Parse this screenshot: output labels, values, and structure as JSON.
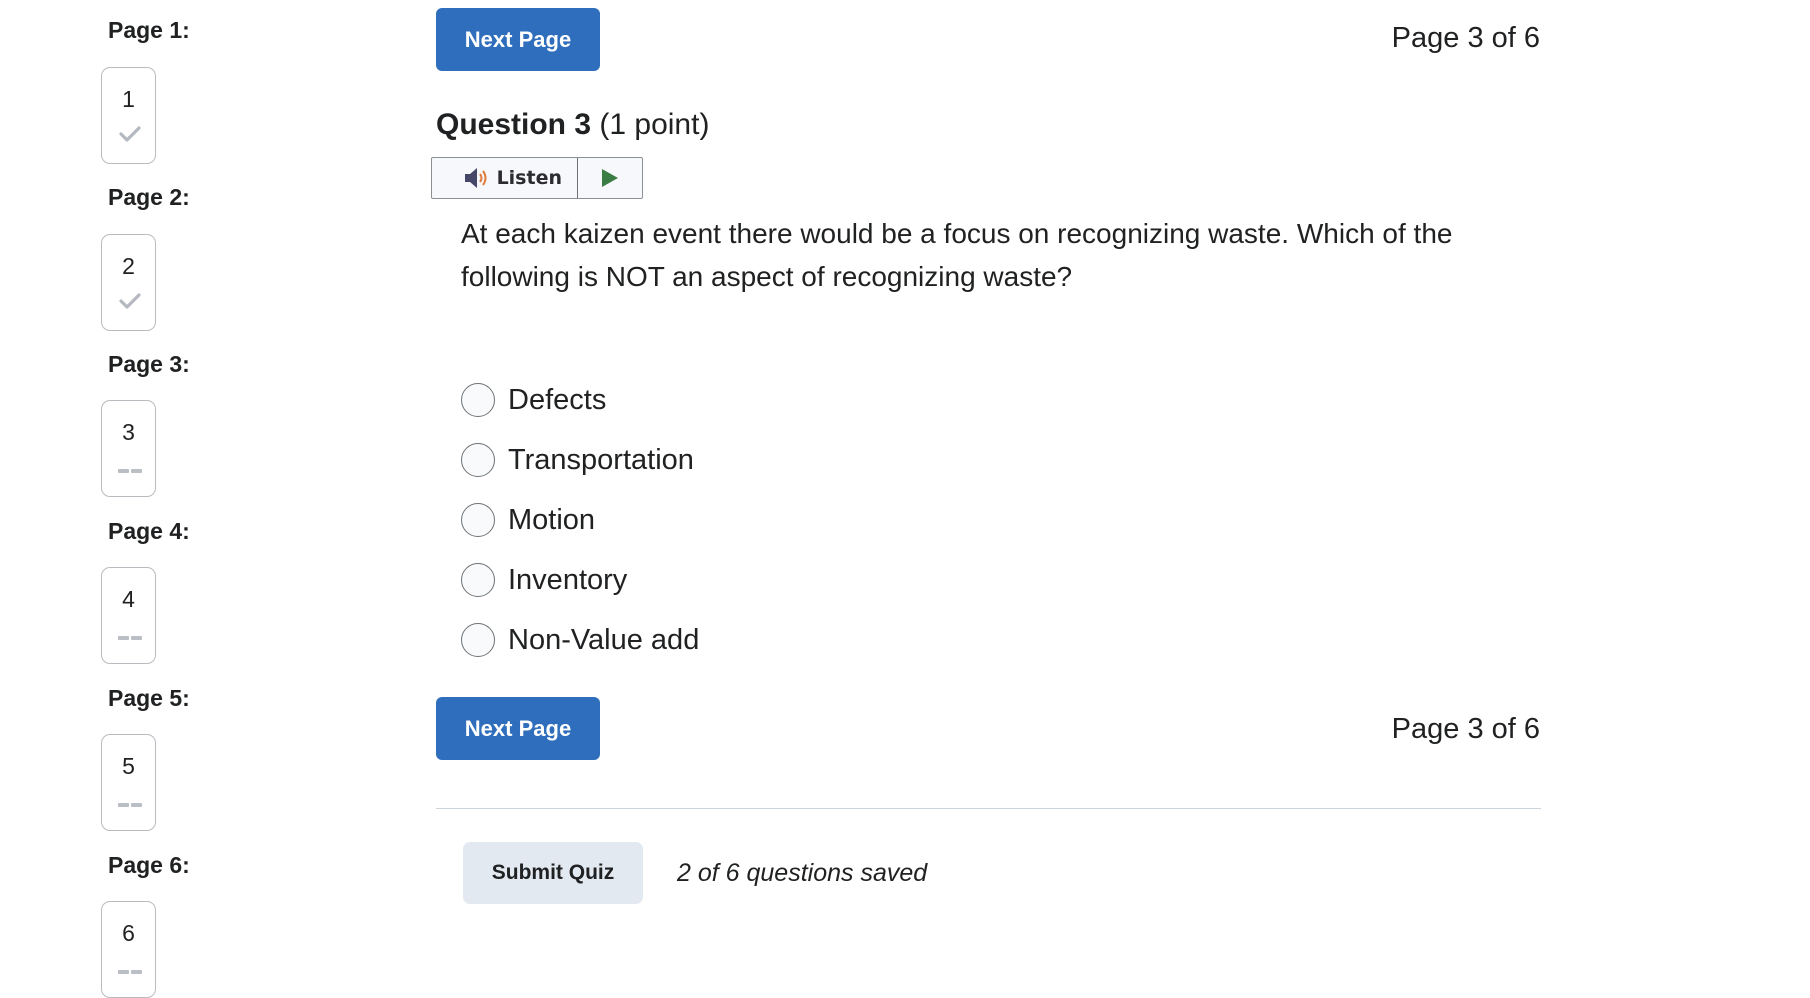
{
  "sidebar": {
    "pages": [
      {
        "label": "Page 1:",
        "number": "1",
        "status": "saved",
        "status_icon": "check-icon"
      },
      {
        "label": "Page 2:",
        "number": "2",
        "status": "saved",
        "status_icon": "check-icon"
      },
      {
        "label": "Page 3:",
        "number": "3",
        "status": "unanswered",
        "status_icon": "dash-icon"
      },
      {
        "label": "Page 4:",
        "number": "4",
        "status": "unanswered",
        "status_icon": "dash-icon"
      },
      {
        "label": "Page 5:",
        "number": "5",
        "status": "unanswered",
        "status_icon": "dash-icon"
      },
      {
        "label": "Page 6:",
        "number": "6",
        "status": "unanswered",
        "status_icon": "dash-icon"
      }
    ]
  },
  "nav": {
    "next_label_top": "Next Page",
    "next_label_bottom": "Next Page",
    "page_indicator_top": "Page 3 of 6",
    "page_indicator_bottom": "Page 3 of 6"
  },
  "question": {
    "title": "Question 3",
    "points": "(1 point)",
    "listen_label": "Listen",
    "text": "At each kaizen event there would be a focus on recognizing waste. Which of the following is NOT an aspect of recognizing waste?",
    "choices": [
      {
        "label": "Defects",
        "selected": false
      },
      {
        "label": "Transportation",
        "selected": false
      },
      {
        "label": "Motion",
        "selected": false
      },
      {
        "label": "Inventory",
        "selected": false
      },
      {
        "label": "Non-Value add",
        "selected": false
      }
    ]
  },
  "footer": {
    "submit_label": "Submit Quiz",
    "saved_status": "2 of 6 questions saved"
  },
  "colors": {
    "primary": "#2f6ebc",
    "submit_bg": "#e3e9f1",
    "speaker": "#47476a",
    "speaker_waves": "#e07a3a",
    "play": "#3a7d44"
  }
}
